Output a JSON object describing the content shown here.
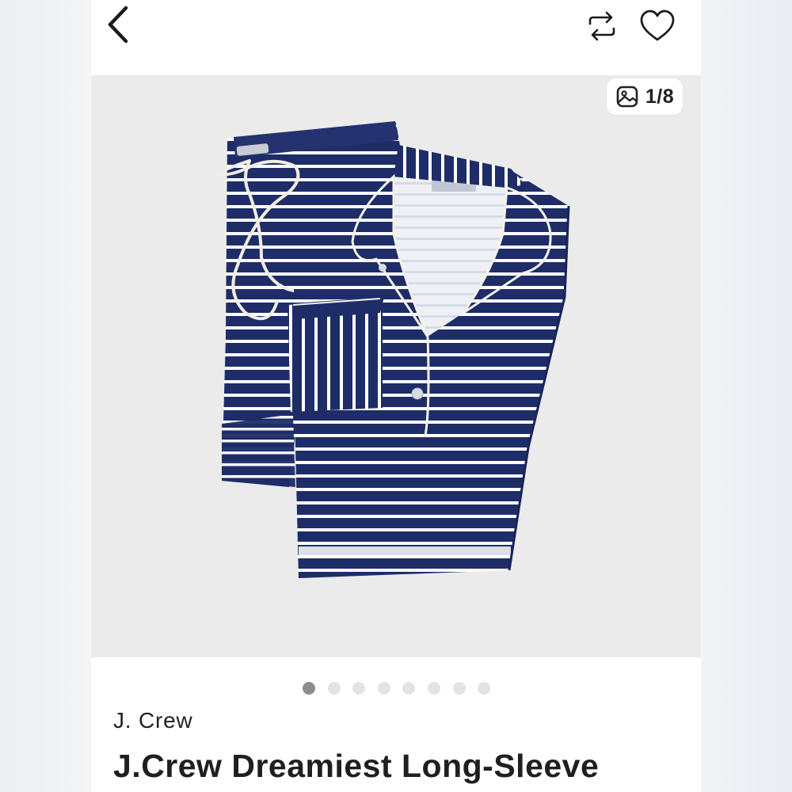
{
  "nav": {
    "back_icon": "chevron-left-icon",
    "share_icon": "share-repost-icon",
    "like_icon": "heart-icon"
  },
  "gallery": {
    "counter": "1/8",
    "counter_icon": "image-icon",
    "image_subject": "striped-pajama-set",
    "label_text": "J.CREW",
    "total_images": 8,
    "active_index": 1,
    "colors": {
      "navy": "#1e2d68",
      "stripe": "#ffffff",
      "background": "#ebebeb"
    }
  },
  "listing": {
    "brand": "J. Crew",
    "title": "J.Crew Dreamiest Long-Sleeve"
  }
}
